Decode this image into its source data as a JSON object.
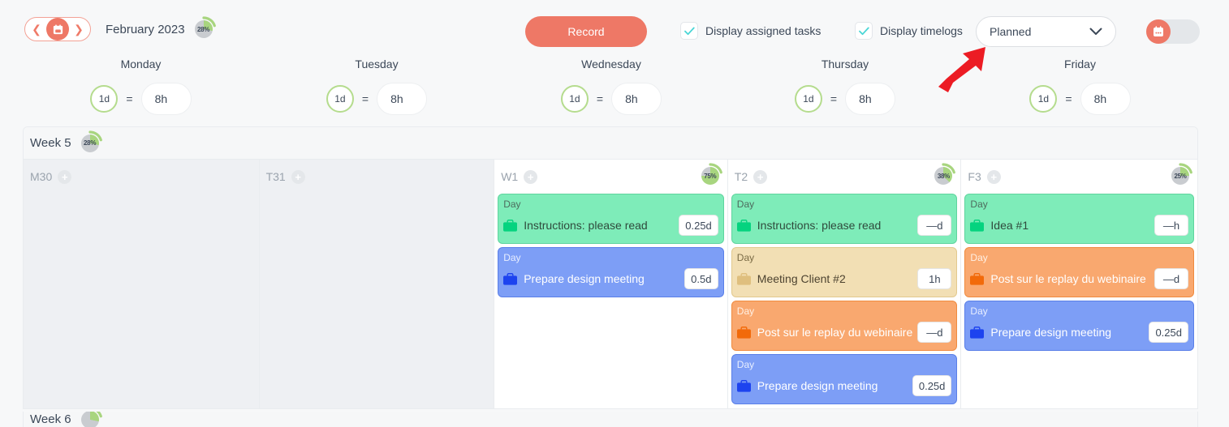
{
  "toolbar": {
    "prev_icon": "chevron-left-icon",
    "today_icon": "calendar-icon",
    "next_icon": "chevron-right-icon",
    "period_label": "February 2023",
    "period_progress": "28%",
    "period_progress_value": 28,
    "record_label": "Record",
    "display_assigned_tasks_label": "Display assigned tasks",
    "display_assigned_tasks_checked": true,
    "display_timelogs_label": "Display timelogs",
    "display_timelogs_checked": true,
    "mode_select_value": "Planned",
    "mode_select_options": [
      "Planned"
    ],
    "calendar_toggle_on": false,
    "accent_color": "#ee7866",
    "check_color": "#4ad6d6",
    "arc_color": "#a8d57f"
  },
  "day_headers": [
    {
      "name": "Monday",
      "days": "1d",
      "hours": "8h"
    },
    {
      "name": "Tuesday",
      "days": "1d",
      "hours": "8h"
    },
    {
      "name": "Wednesday",
      "days": "1d",
      "hours": "8h"
    },
    {
      "name": "Thursday",
      "days": "1d",
      "hours": "8h"
    },
    {
      "name": "Friday",
      "days": "1d",
      "hours": "8h"
    }
  ],
  "week": {
    "label": "Week 5",
    "progress": "28%",
    "progress_value": 28
  },
  "next_week": {
    "label": "Week 6"
  },
  "columns": [
    {
      "code": "M30",
      "active": false,
      "progress": null,
      "progress_value": null,
      "add_icon": "plus-icon",
      "cards": []
    },
    {
      "code": "T31",
      "active": false,
      "progress": null,
      "progress_value": null,
      "add_icon": "plus-icon",
      "cards": []
    },
    {
      "code": "W1",
      "active": true,
      "progress": "75%",
      "progress_value": 75,
      "add_icon": "plus-icon",
      "cards": [
        {
          "kind": "Day",
          "title": "Instructions: please read",
          "amount": "0.25d",
          "color": "green"
        },
        {
          "kind": "Day",
          "title": "Prepare design meeting",
          "amount": "0.5d",
          "color": "blue"
        }
      ]
    },
    {
      "code": "T2",
      "active": true,
      "progress": "38%",
      "progress_value": 38,
      "add_icon": "plus-icon",
      "cards": [
        {
          "kind": "Day",
          "title": "Instructions: please read",
          "amount": "—d",
          "color": "green"
        },
        {
          "kind": "Day",
          "title": "Meeting Client #2",
          "amount": "1h",
          "color": "sand"
        },
        {
          "kind": "Day",
          "title": "Post sur le replay du webinaire",
          "amount": "—d",
          "color": "orange"
        },
        {
          "kind": "Day",
          "title": "Prepare design meeting",
          "amount": "0.25d",
          "color": "blue"
        }
      ]
    },
    {
      "code": "F3",
      "active": true,
      "progress": "25%",
      "progress_value": 25,
      "add_icon": "plus-icon",
      "cards": [
        {
          "kind": "Day",
          "title": "Idea #1",
          "amount": "—h",
          "color": "green"
        },
        {
          "kind": "Day",
          "title": "Post sur le replay du webinaire",
          "amount": "—d",
          "color": "orange"
        },
        {
          "kind": "Day",
          "title": "Prepare design meeting",
          "amount": "0.25d",
          "color": "blue"
        }
      ]
    }
  ],
  "annotation": {
    "arrow_icon": "red-arrow-up-right",
    "color": "#ec1c24"
  }
}
